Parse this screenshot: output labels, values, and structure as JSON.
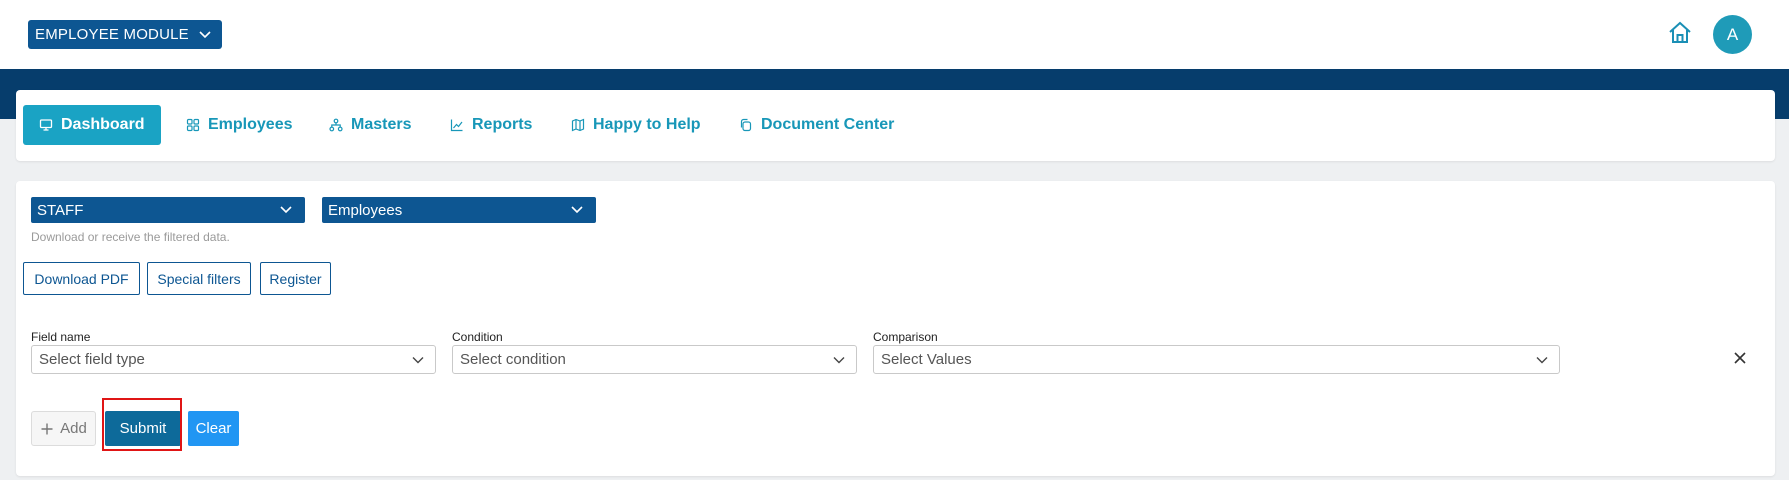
{
  "header": {
    "module_label": "EMPLOYEE MODULE",
    "avatar_initial": "A"
  },
  "nav": {
    "items": [
      {
        "label": "Dashboard",
        "icon": "monitor-icon",
        "active": true
      },
      {
        "label": "Employees",
        "icon": "grid-icon",
        "active": false
      },
      {
        "label": "Masters",
        "icon": "sitemap-icon",
        "active": false
      },
      {
        "label": "Reports",
        "icon": "line-chart-icon",
        "active": false
      },
      {
        "label": "Happy to Help",
        "icon": "map-icon",
        "active": false
      },
      {
        "label": "Document Center",
        "icon": "copy-icon",
        "active": false
      }
    ]
  },
  "filters": {
    "category_value": "STAFF",
    "entity_value": "Employees",
    "hint": "Download or receive the filtered data."
  },
  "actions": {
    "download_pdf": "Download PDF",
    "special_filters": "Special filters",
    "register": "Register"
  },
  "criteria": {
    "field_name_label": "Field name",
    "field_name_placeholder": "Select field type",
    "condition_label": "Condition",
    "condition_placeholder": "Select condition",
    "comparison_label": "Comparison",
    "comparison_placeholder": "Select Values"
  },
  "buttons": {
    "add": "Add",
    "submit": "Submit",
    "clear": "Clear"
  },
  "colors": {
    "brand_dark": "#063d6c",
    "brand": "#0d5692",
    "accent": "#1aa3c4",
    "clear": "#2196f3",
    "highlight": "#e01515"
  }
}
